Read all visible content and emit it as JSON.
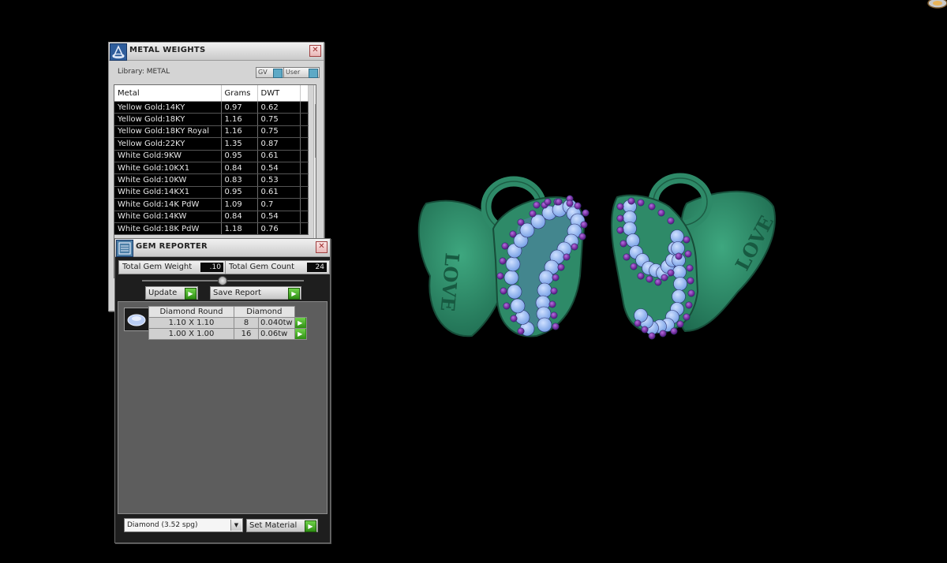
{
  "metal_weights": {
    "title": "METAL WEIGHTS",
    "library_label": "Library: METAL",
    "toggles": {
      "gv": "GV",
      "user": "User"
    },
    "columns": [
      "Metal",
      "Grams",
      "DWT"
    ],
    "rows": [
      [
        "Yellow Gold:14KY",
        "0.97",
        "0.62"
      ],
      [
        "Yellow Gold:18KY",
        "1.16",
        "0.75"
      ],
      [
        "Yellow Gold:18KY Royal",
        "1.16",
        "0.75"
      ],
      [
        "Yellow Gold:22KY",
        "1.35",
        "0.87"
      ],
      [
        "White Gold:9KW",
        "0.95",
        "0.61"
      ],
      [
        "White Gold:10KX1",
        "0.84",
        "0.54"
      ],
      [
        "White Gold:10KW",
        "0.83",
        "0.53"
      ],
      [
        "White Gold:14KX1",
        "0.95",
        "0.61"
      ],
      [
        "White Gold:14K PdW",
        "1.09",
        "0.7"
      ],
      [
        "White Gold:14KW",
        "0.84",
        "0.54"
      ],
      [
        "White Gold:18K PdW",
        "1.18",
        "0.76"
      ]
    ],
    "close_glyph": "✕",
    "scroll_up_glyph": "▲",
    "scroll_down_glyph": "▼"
  },
  "gem_reporter": {
    "title": "GEM REPORTER",
    "total_weight_label": "Total Gem Weight",
    "total_weight_value": ".10",
    "total_count_label": "Total Gem Count",
    "total_count_value": "24",
    "update_label": "Update",
    "save_report_label": "Save Report",
    "gem_columns": [
      "Diamond Round",
      "Diamond"
    ],
    "gems": [
      {
        "size": "1.10 X 1.10",
        "count": "8",
        "weight": "0.040tw"
      },
      {
        "size": "1.00 X 1.00",
        "count": "16",
        "weight": "0.06tw"
      }
    ],
    "material_select": "Diamond    (3.52 spg)",
    "set_material_label": "Set Material",
    "go_glyph": "▶",
    "dropdown_glyph": "▼",
    "close_glyph": "✕"
  },
  "viewport": {
    "engraving": "LOVE",
    "colors": {
      "metal": "#2e8a68",
      "metal_dark": "#1f6b50",
      "gem_white": "#8fb6f2",
      "gem_purple": "#7a2ea8",
      "background": "#000000"
    }
  }
}
